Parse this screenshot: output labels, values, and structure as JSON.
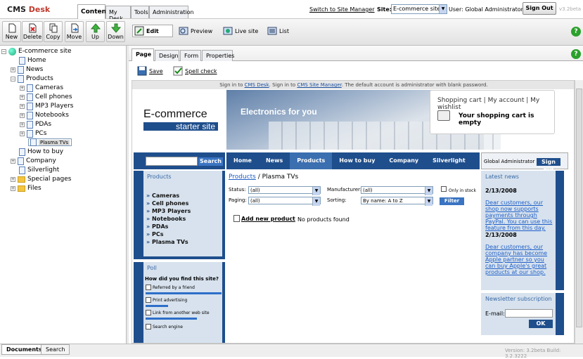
{
  "app": {
    "logo_cms": "CMS",
    "logo_desk": "Desk",
    "version": "v3.2beta"
  },
  "top_tabs": [
    "Content",
    "My Desk",
    "Tools",
    "Administration"
  ],
  "header": {
    "switch_link": "Switch to Site Manager",
    "site_label": "Site:",
    "site_value": "E-commerce site",
    "user_label": "User: Global Administrator",
    "signout": "Sign Out"
  },
  "toolbar": {
    "buttons": [
      "New",
      "Delete",
      "Copy",
      "Move",
      "Up",
      "Down"
    ]
  },
  "view_toolbar": {
    "edit": "Edit",
    "preview": "Preview",
    "live": "Live site",
    "list": "List"
  },
  "tree": [
    {
      "label": "E-commerce site",
      "level": 0
    },
    {
      "label": "Home",
      "level": 1
    },
    {
      "label": "News",
      "level": 1
    },
    {
      "label": "Products",
      "level": 1
    },
    {
      "label": "Cameras",
      "level": 2
    },
    {
      "label": "Cell phones",
      "level": 2
    },
    {
      "label": "MP3 Players",
      "level": 2
    },
    {
      "label": "Notebooks",
      "level": 2
    },
    {
      "label": "PDAs",
      "level": 2
    },
    {
      "label": "PCs",
      "level": 2
    },
    {
      "label": "Plasma TVs",
      "level": 2
    },
    {
      "label": "How to buy",
      "level": 1
    },
    {
      "label": "Company",
      "level": 1
    },
    {
      "label": "Silverlight",
      "level": 1
    },
    {
      "label": "Special pages",
      "level": 1
    },
    {
      "label": "Files",
      "level": 1
    }
  ],
  "page_tabs": [
    "Page",
    "Design",
    "Form",
    "Properties"
  ],
  "subbar": {
    "save": "Save",
    "spell": "Spell check"
  },
  "preview": {
    "info_prefix": "Sign in to ",
    "info_link1": "CMS Desk",
    "info_mid": ". Sign in to ",
    "info_link2": "CMS Site Manager",
    "info_suffix": ". The default account is administrator with blank password.",
    "brand_line1": "E-commerce",
    "brand_line2": "starter site",
    "banner_text": "Electronics for you",
    "cart_links": "Shopping cart | My account | My wishlist",
    "cart_empty": "Your shopping cart is empty",
    "search_btn": "Search",
    "nav": [
      "Home",
      "News",
      "Products",
      "How to buy",
      "Company",
      "Silverlight"
    ],
    "user_name": "Global Administrator",
    "user_signout": "Sign out",
    "products_head": "Products",
    "categories": [
      "Cameras",
      "Cell phones",
      "MP3 Players",
      "Notebooks",
      "PDAs",
      "PCs",
      "Plasma TVs"
    ],
    "breadcrumb_link": "Products",
    "breadcrumb_rest": " / Plasma TVs",
    "status_label": "Status:",
    "status_value": "(all)",
    "manuf_label": "Manufacturer:",
    "manuf_value": "(all)",
    "only_stock": "Only in stock",
    "paging_label": "Paging:",
    "paging_value": "(all)",
    "sorting_label": "Sorting:",
    "sorting_value": "By name: A to Z",
    "filter_btn": "Filter",
    "add_product": "Add new product",
    "no_products": "No products found",
    "poll_head": "Poll",
    "poll_question": "How did you find this site?",
    "poll_options": [
      {
        "label": "Referred by a friend",
        "fraction": 1.0
      },
      {
        "label": "Print advertising",
        "fraction": 0.3
      },
      {
        "label": "Link from another web site",
        "fraction": 0.68
      },
      {
        "label": "Search engine",
        "fraction": 0
      }
    ],
    "latest_head": "Latest news",
    "news": [
      {
        "date": "2/13/2008",
        "text": "Dear customers, our shop now supports payments through PayPal. You can use this feature from this day."
      },
      {
        "date": "2/13/2008",
        "text": "Dear customers, our company has become Apple partner so you can buy Apple's great products at our shop."
      }
    ],
    "newsletter_head": "Newsletter subscription",
    "email_label": "E-mail:",
    "ok_btn": "OK"
  },
  "bottom_tabs": [
    "Documents",
    "Search"
  ],
  "build_info": "Version: 3.2beta Build: 3.2.3222",
  "colors": {
    "accent": "#1f4e8c",
    "brand_red": "#c0392b",
    "help_green": "#2ca02c"
  }
}
